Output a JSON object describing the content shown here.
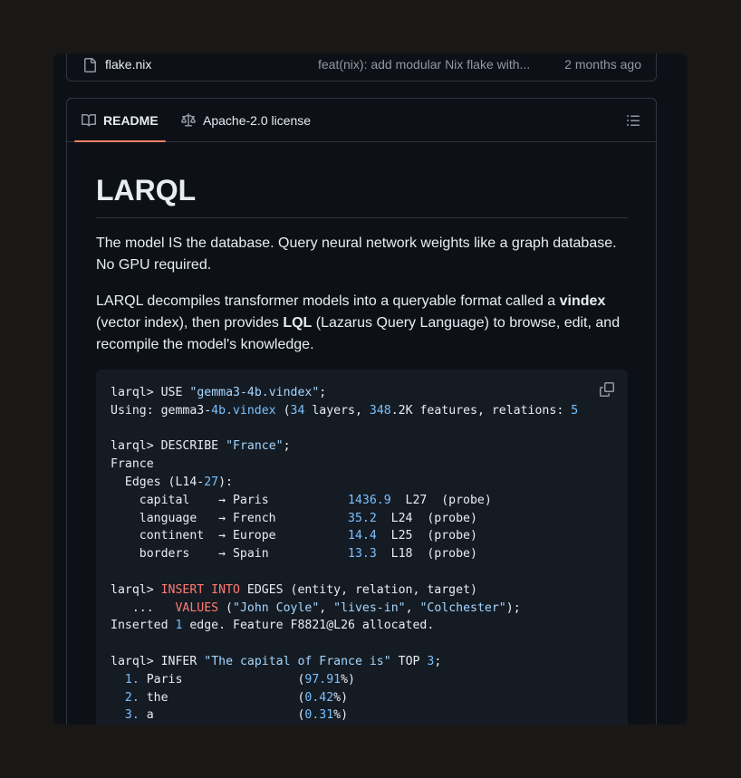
{
  "file_row": {
    "name": "flake.nix",
    "commit": "feat(nix): add modular Nix flake with...",
    "time": "2 months ago"
  },
  "tabs": {
    "readme": "README",
    "license": "Apache-2.0 license"
  },
  "readme": {
    "title": "LARQL",
    "p1": "The model IS the database. Query neural network weights like a graph database. No GPU required.",
    "p2_a": "LARQL decompiles transformer models into a queryable format called a ",
    "p2_vindex": "vindex",
    "p2_b": " (vector index), then provides ",
    "p2_lql": "LQL",
    "p2_c": " (Lazarus Query Language) to browse, edit, and recompile the model's knowledge."
  },
  "code": {
    "prompt": "larql>",
    "l1_cmd": "USE",
    "l1_str": "\"gemma3-4b.vindex\"",
    "l2_a": "Using: gemma3-",
    "l2_4b": "4b",
    "l2_vindex": ".vindex",
    "l2_b": " (",
    "l2_34": "34",
    "l2_c": " layers, ",
    "l2_348": "348",
    "l2_d": ".2K features, relations: ",
    "l2_5": "5",
    "l4_cmd": "DESCRIBE",
    "l4_str": "\"France\"",
    "l5": "France",
    "l6_a": "  Edges (L14-",
    "l6_27": "27",
    "l6_b": "):",
    "edges": [
      {
        "rel": "capital",
        "target": "Paris",
        "score": "1436.9",
        "layer": "L27",
        "tag": "(probe)"
      },
      {
        "rel": "language",
        "target": "French",
        "score": "35.2",
        "layer": "L24",
        "tag": "(probe)"
      },
      {
        "rel": "continent",
        "target": "Europe",
        "score": "14.4",
        "layer": "L25",
        "tag": "(probe)"
      },
      {
        "rel": "borders",
        "target": "Spain",
        "score": "13.3",
        "layer": "L18",
        "tag": "(probe)"
      }
    ],
    "insert_kw": "INSERT INTO",
    "insert_rest": " EDGES (entity, relation, target)",
    "cont": "   ...   ",
    "values_kw": "VALUES",
    "v1": "\"John Coyle\"",
    "v2": "\"lives-in\"",
    "v3": "\"Colchester\"",
    "inserted_a": "Inserted ",
    "inserted_1": "1",
    "inserted_b": " edge. Feature F8821@L26 allocated.",
    "infer_cmd": "INFER",
    "infer_str": "\"The capital of France is\"",
    "infer_top": "TOP",
    "infer_3": "3",
    "results": [
      {
        "n": "1.",
        "tok": "Paris",
        "pct": "97.91"
      },
      {
        "n": "2.",
        "tok": "the",
        "pct": "0.42"
      },
      {
        "n": "3.",
        "tok": "a",
        "pct": "0.31"
      }
    ]
  }
}
